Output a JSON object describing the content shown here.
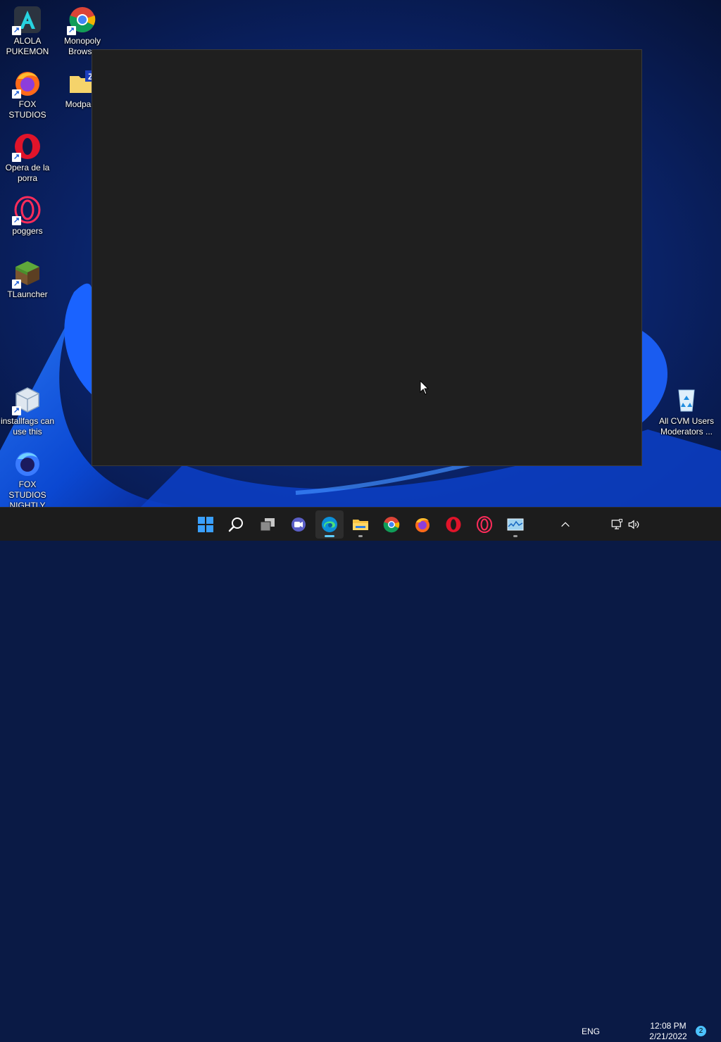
{
  "desktop": {
    "icons": [
      {
        "label": "ALOLA PUKEMON",
        "icon": "alola-app-icon",
        "shortcut": true
      },
      {
        "label": "Monopoly Browse",
        "icon": "chrome-icon",
        "shortcut": true
      },
      {
        "label": "FOX STUDIOS",
        "icon": "firefox-icon",
        "shortcut": true
      },
      {
        "label": "Modpack",
        "icon": "folder-zip-icon",
        "shortcut": false
      },
      {
        "label": "Opera de la porra",
        "icon": "opera-icon",
        "shortcut": true
      },
      {
        "label": "poggers",
        "icon": "opera-gx-icon",
        "shortcut": true
      },
      {
        "label": "TLauncher",
        "icon": "minecraft-block-icon",
        "shortcut": true
      },
      {
        "label": "installfags can use this",
        "icon": "virtualbox-icon",
        "shortcut": true
      },
      {
        "label": "FOX STUDIOS NIGHTLY",
        "icon": "firefox-nightly-icon",
        "shortcut": false
      },
      {
        "label": "All CVM Users Moderators ...",
        "icon": "recycle-bin-icon",
        "shortcut": false
      }
    ]
  },
  "window": {
    "title": "",
    "content": ""
  },
  "taskbar": {
    "apps": [
      {
        "name": "Start",
        "icon": "windows-start-icon",
        "running": false,
        "active": false
      },
      {
        "name": "Search",
        "icon": "search-icon",
        "running": false,
        "active": false
      },
      {
        "name": "Task View",
        "icon": "task-view-icon",
        "running": false,
        "active": false
      },
      {
        "name": "Chat",
        "icon": "chat-icon",
        "running": false,
        "active": false
      },
      {
        "name": "Microsoft Edge",
        "icon": "edge-icon",
        "running": true,
        "active": true
      },
      {
        "name": "File Explorer",
        "icon": "file-explorer-icon",
        "running": true,
        "active": false
      },
      {
        "name": "Google Chrome",
        "icon": "chrome-icon",
        "running": false,
        "active": false
      },
      {
        "name": "Firefox",
        "icon": "firefox-icon",
        "running": false,
        "active": false
      },
      {
        "name": "Opera",
        "icon": "opera-icon",
        "running": false,
        "active": false
      },
      {
        "name": "Opera GX",
        "icon": "opera-gx-icon",
        "running": false,
        "active": false
      },
      {
        "name": "Task Manager",
        "icon": "task-manager-icon",
        "running": true,
        "active": false
      }
    ],
    "tray": {
      "language": "ENG",
      "time": "12:08 PM",
      "date": "2/21/2022",
      "notification_count": "2"
    }
  },
  "colors": {
    "window_bg": "#1f1f1f",
    "taskbar_bg": "#1c1c1c",
    "accent": "#60cdff"
  }
}
